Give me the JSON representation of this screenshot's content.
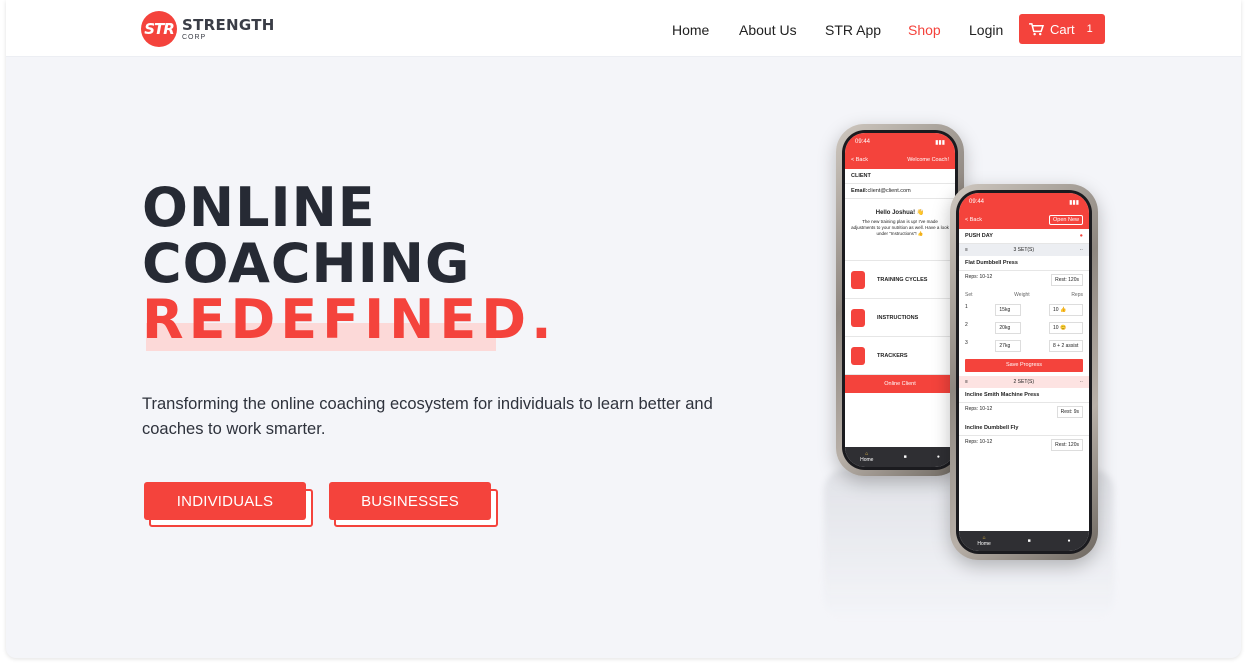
{
  "nav": {
    "logo_badge": "STR",
    "logo_title": "STRENGTH",
    "logo_sub": "CORP",
    "links": [
      "Home",
      "About Us",
      "STR App",
      "Shop",
      "Login"
    ],
    "active_link": "Shop",
    "cart_label": "Cart",
    "cart_count": "1"
  },
  "hero": {
    "line1": "ONLINE",
    "line2": "COACHING",
    "line3": "REDEFINED.",
    "subtitle": "Transforming the online coaching ecosystem for individuals to learn better and coaches to work smarter.",
    "cta_individuals": "INDIVIDUALS",
    "cta_businesses": "BUSINESSES"
  },
  "phone_back": {
    "time": "09:44",
    "back": "< Back",
    "welcome": "Welcome Coach!",
    "client_heading": "CLIENT",
    "email_label": "Email:",
    "email_value": "client@client.com",
    "greeting": "Hello Joshua! 👋",
    "message": "The new training plan is up! I've made adjustments to your nutrition as well. Have a look under \"Instructions\"! 👍",
    "menu": [
      "TRAINING CYCLES",
      "INSTRUCTIONS",
      "TRACKERS"
    ],
    "action": "Online Client",
    "tab_home": "Home"
  },
  "phone_front": {
    "time": "09:44",
    "back": "< Back",
    "open_new": "Open New",
    "day": "PUSH DAY",
    "set1": "3 SET(S)",
    "exercise1": "Flat Dumbbell Press",
    "reps1": "Reps: 10-12",
    "rest1": "Rest: 120s",
    "col_set": "Set",
    "col_weight": "Weight",
    "col_reps": "Reps",
    "rows": [
      {
        "set": "1",
        "weight": "15kg",
        "reps": "10 👍"
      },
      {
        "set": "2",
        "weight": "20kg",
        "reps": "10 😊"
      },
      {
        "set": "3",
        "weight": "27kg",
        "reps": "8 + 2 assist"
      }
    ],
    "save": "Save Progress",
    "set2": "2 SET(S)",
    "exercise2": "Incline Smith Machine Press",
    "reps2": "Reps: 10-12",
    "rest2": "Rest: 9s",
    "exercise3": "Incline Dumbbell Fly",
    "reps3": "Reps: 10-12",
    "rest3": "Rest: 120s",
    "tab_home": "Home"
  },
  "colors": {
    "accent": "#f4433c",
    "dark_text": "#262a34",
    "background": "#f4f5f9"
  }
}
